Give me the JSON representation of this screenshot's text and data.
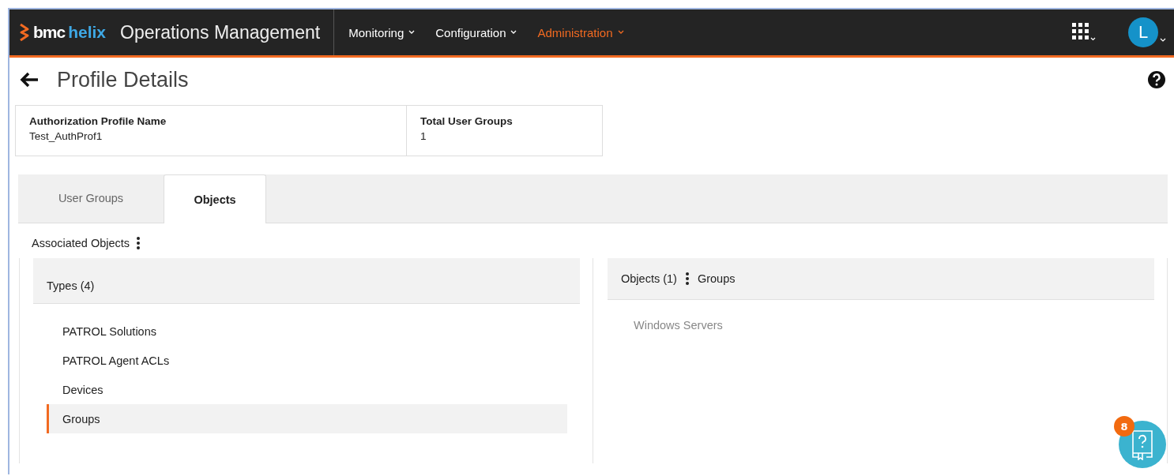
{
  "header": {
    "logo": {
      "brand": "bmc",
      "product": "helix"
    },
    "app_title": "Operations Management",
    "nav": [
      {
        "label": "Monitoring",
        "selected": false
      },
      {
        "label": "Configuration",
        "selected": false
      },
      {
        "label": "Administration",
        "selected": true
      }
    ],
    "avatar": "L"
  },
  "page": {
    "title": "Profile Details"
  },
  "summary": [
    {
      "label": "Authorization Profile Name",
      "value": "Test_AuthProf1"
    },
    {
      "label": "Total User Groups",
      "value": "1"
    }
  ],
  "tabs": [
    {
      "label": "User Groups",
      "selected": false
    },
    {
      "label": "Objects",
      "selected": true
    }
  ],
  "section_title": "Associated Objects",
  "types_panel": {
    "title": "Types (4)",
    "items": [
      {
        "label": "PATROL Solutions",
        "selected": false
      },
      {
        "label": "PATROL Agent ACLs",
        "selected": false
      },
      {
        "label": "Devices",
        "selected": false
      },
      {
        "label": "Groups",
        "selected": true
      }
    ]
  },
  "objects_panel": {
    "title": "Objects (1)",
    "subtitle": "Groups",
    "items": [
      "Windows Servers"
    ]
  },
  "help_badge": "8"
}
